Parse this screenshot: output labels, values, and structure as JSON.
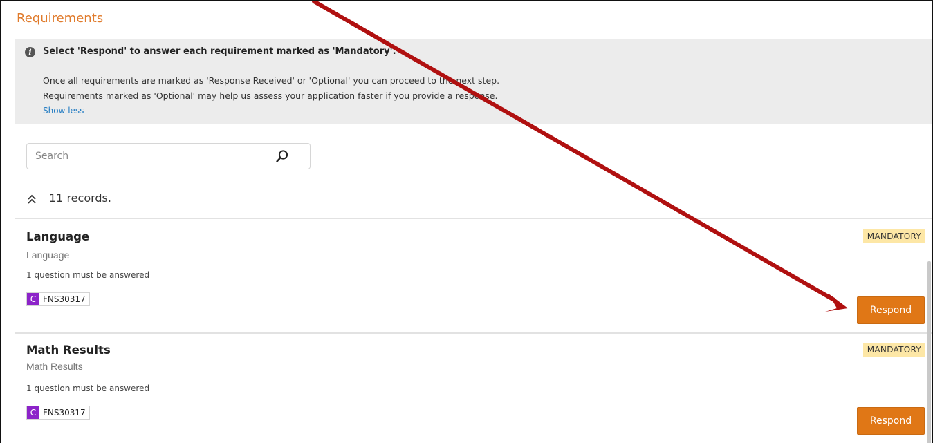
{
  "header": {
    "title": "Requirements"
  },
  "info": {
    "headline": "Select 'Respond' to answer each requirement marked as 'Mandatory'.",
    "line1": "Once all requirements are marked as 'Response Received' or 'Optional' you can proceed to the next step.",
    "line2": "Requirements marked as 'Optional' may help us assess your application faster if you provide a response.",
    "toggle_label": "Show less",
    "icon": "info-icon"
  },
  "search": {
    "placeholder": "Search",
    "value": "",
    "icon": "search-icon"
  },
  "list": {
    "records_label": "11 records.",
    "collapse_icon": "double-chevron-up-icon"
  },
  "requirements": [
    {
      "title": "Language",
      "subtitle": "Language",
      "note": "1 question must be answered",
      "badge": "MANDATORY",
      "tag_letter": "C",
      "tag_code": "FNS30317",
      "button_label": "Respond"
    },
    {
      "title": "Math Results",
      "subtitle": "Math Results",
      "note": "1 question must be answered",
      "badge": "MANDATORY",
      "tag_letter": "C",
      "tag_code": "FNS30317",
      "button_label": "Respond"
    }
  ],
  "colors": {
    "accent_orange": "#e07716",
    "title_orange": "#e07b2c",
    "badge_yellow": "#fde7a6",
    "tag_purple": "#8c23c9",
    "link_blue": "#1f7ac2",
    "annotation_arrow": "#b01010"
  }
}
